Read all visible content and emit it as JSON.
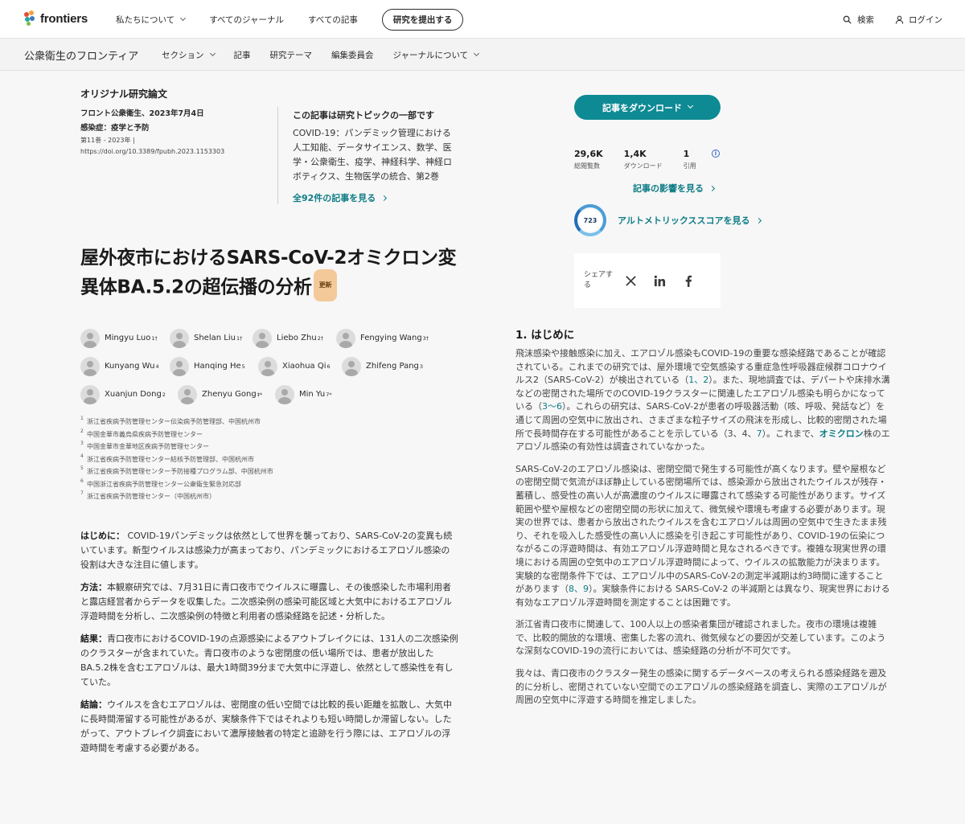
{
  "brand": {
    "name": "frontiers",
    "accent": "#0e8a94"
  },
  "topnav": {
    "about": "私たちについて",
    "journals": "すべてのジャーナル",
    "articles": "すべての記事",
    "submit": "研究を提出する",
    "search": "検索",
    "login": "ログイン"
  },
  "journal": {
    "title": "公衆衛生のフロンティア",
    "nav": [
      "セクション",
      "記事",
      "研究テーマ",
      "編集委員会",
      "ジャーナルについて"
    ]
  },
  "meta": {
    "type": "オリジナル研究論文",
    "published": "フロント公衆衛生、2023年7月4日",
    "section": "感染症：疫学と予防",
    "volume": "第11巻 - 2023年 |",
    "doi": "https://doi.org/10.3389/fpubh.2023.1153303"
  },
  "topic": {
    "heading": "この記事は研究トピックの一部です",
    "body": "COVID-19：パンデミック管理における人工知能、データサイエンス、数学、医学・公衆衛生、疫学、神経科学、神経ロボティクス、生物医学の統合、第2巻",
    "link": "全92件の記事を見る"
  },
  "article": {
    "title": "屋外夜市におけるSARS-CoV-2オミクロン変異体BA.5.2の超伝播の分析",
    "badge": "更新"
  },
  "authors": [
    [
      {
        "name": "Mingyu Luo",
        "sup": "1†"
      },
      {
        "name": "Shelan Liu",
        "sup": "1†"
      },
      {
        "name": "Liebo Zhu",
        "sup": "2†"
      },
      {
        "name": "Fengying Wang",
        "sup": "3†"
      }
    ],
    [
      {
        "name": "Kunyang Wu",
        "sup": "4"
      },
      {
        "name": "Hanqing He",
        "sup": "5"
      },
      {
        "name": "Xiaohua Qi",
        "sup": "6"
      },
      {
        "name": "Zhifeng Pang",
        "sup": "3"
      }
    ],
    [
      {
        "name": "Xuanjun Dong",
        "sup": "2"
      },
      {
        "name": "Zhenyu Gong",
        "sup": "‡*"
      },
      {
        "name": "Min Yu",
        "sup": "7*"
      }
    ]
  ],
  "affiliations": [
    {
      "n": "1",
      "text": "浙江省疾病予防管理センター伝染病予防管理部、中国杭州市"
    },
    {
      "n": "2",
      "text": "中国金華市義烏県疾病予防管理センター"
    },
    {
      "n": "3",
      "text": "中国金華市金華地区疾病予防管理センター"
    },
    {
      "n": "4",
      "text": "浙江省疾病予防管理センター結核予防管理部、中国杭州市"
    },
    {
      "n": "5",
      "text": "浙江省疾病予防管理センター予防接種プログラム部、中国杭州市"
    },
    {
      "n": "6",
      "text": "中国浙江省疾病予防管理センター公衆衛生緊急対応部"
    },
    {
      "n": "7",
      "text": "浙江省疾病予防管理センター（中国杭州市）"
    }
  ],
  "abstract": [
    {
      "label": "はじめに：",
      "text": " COVID-19パンデミックは依然として世界を襲っており、SARS-CoV-2の変異も続いています。新型ウイルスは感染力が高まっており、パンデミックにおけるエアロゾル感染の役割は大きな注目に値します。"
    },
    {
      "label": "方法：",
      "text": "本観察研究では、7月31日に青口夜市でウイルスに曝露し、その後感染した市場利用者と露店経営者からデータを収集した。二次感染例の感染可能区域と大気中におけるエアロゾル浮遊時間を分析し、二次感染例の特徴と利用者の感染経路を記述・分析した。"
    },
    {
      "label": "結果：",
      "text": "青口夜市におけるCOVID-19の点源感染によるアウトブレイクには、131人の二次感染例のクラスターが含まれていた。青口夜市のような密閉度の低い場所では、患者が放出したBA.5.2株を含むエアロゾルは、最大1時間39分まで大気中に浮遊し、依然として感染性を有していた。"
    },
    {
      "label": "結論：",
      "text": "ウイルスを含むエアロゾルは、密閉度の低い空間では比較的長い距離を拡散し、大気中に長時間滞留する可能性があるが、実験条件下ではそれよりも短い時間しか滞留しない。したがって、アウトブレイク調査において濃厚接触者の特定と追跡を行う際には、エアロゾルの浮遊時間を考慮する必要がある。"
    }
  ],
  "sidebar": {
    "download": "記事をダウンロード",
    "stats": [
      {
        "value": "29,6K",
        "label": "総閲覧数"
      },
      {
        "value": "1,4K",
        "label": "ダウンロード"
      },
      {
        "value": "1",
        "label": "引用"
      }
    ],
    "impact_link": "記事の影響を見る",
    "altmetric_score": "723",
    "altmetric_link": "アルトメトリックススコアを見る",
    "share_label": "シェアする",
    "share_icons": [
      "x-icon",
      "linkedin-icon",
      "facebook-icon"
    ]
  },
  "section1": {
    "title": "1. はじめに",
    "p1a": "飛沫感染や接触感染に加え、エアロゾル感染もCOVID-19の重要な感染経路であることが確認されている。これまでの研究では、屋外環境で空気感染する重症急性呼吸器症候群コロナウイルス2（SARS-CoV-2）が検出されている（",
    "p1_ref1": "1、2",
    "p1b": "）。また、現地調査では、デパートや床排水溝などの密閉された場所でのCOVID-19クラスターに関連したエアロゾル感染も明らかになっている（",
    "p1_ref2": "3～6",
    "p1c": "）。これらの研究は、SARS-CoV-2が患者の呼吸器活動（咳、呼吸、発話など）を通じて周囲の空気中に放出され、さまざまな粒子サイズの飛沫を形成し、比較的密閉された場所で長時間存在する可能性があることを示している（3、4、",
    "p1_ref3": "7",
    "p1d": "）。これまで、",
    "p1_ref4": "オミクロン",
    "p1e": "株のエアロゾル感染の有効性は調査されていなかった。",
    "p2a": "SARS-CoV-2のエアロゾル感染は、密閉空間で発生する可能性が高くなります。壁や屋根などの密閉空間で気流がほぼ静止している密閉場所では、感染源から放出されたウイルスが残存・蓄積し、感受性の高い人が高濃度のウイルスに曝露されて感染する可能性があります。サイズ範囲や壁や屋根などの密閉空間の形状に加えて、微気候や環境も考慮する必要があります。現実の世界では、患者から放出されたウイルスを含むエアロゾルは周囲の空気中で生きたまま残り、それを吸入した感受性の高い人に感染を引き起こす可能性があり、COVID-19の伝染につながるこの浮遊時間は、有効エアロゾル浮遊時間と見なされるべきです。複雑な現実世界の環境における周囲の空気中のエアロゾル浮遊時間によって、ウイルスの拡散能力が決まります。実験的な密閉条件下では、エアロゾル中のSARS-CoV-2の測定半減期は約3時間に達することがあります（",
    "p2_ref": "8、9",
    "p2b": "）。実験条件における SARS-CoV-2 の半減期とは異なり、現実世界における有効なエアロゾル浮遊時間を測定することは困難です。",
    "p3": "浙江省青口夜市に関連して、100人以上の感染者集団が確認されました。夜市の環境は複雑で、比較的開放的な環境、密集した客の流れ、微気候などの要因が交差しています。このような深刻なCOVID-19の流行においては、感染経路の分析が不可欠です。",
    "p4": "我々は、青口夜市のクラスター発生の感染に関するデータベースの考えられる感染経路を遡及的に分析し、密閉されていない空間でのエアロゾルの感染経路を調査し、実際のエアロゾルが周囲の空気中に浮遊する時間を推定しました。"
  }
}
